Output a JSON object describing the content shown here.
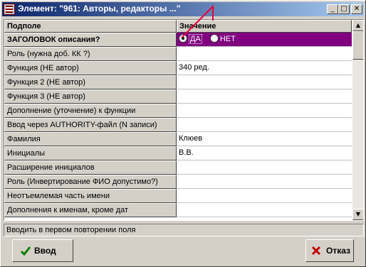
{
  "window": {
    "title": "Элемент: \"961: Авторы, редакторы ...\"",
    "minimize": "_",
    "maximize": "□",
    "close": "✕"
  },
  "grid": {
    "columns": [
      "Подполе",
      "Значение"
    ],
    "rows": [
      {
        "field": "ЗАГОЛОВОК описания?",
        "value": "",
        "type": "radio"
      },
      {
        "field": "Роль (нужна доб. КК ?)",
        "value": ""
      },
      {
        "field": "Функция (НЕ автор)",
        "value": "340 ред."
      },
      {
        "field": "Функция 2 (НЕ автор)",
        "value": ""
      },
      {
        "field": "Функция 3 (НЕ автор)",
        "value": ""
      },
      {
        "field": "Дополнение (уточнение) к функции",
        "value": ""
      },
      {
        "field": "Ввод через AUTHORITY-файл (N записи)",
        "value": ""
      },
      {
        "field": "Фамилия",
        "value": "Клюев"
      },
      {
        "field": "Инициалы",
        "value": "В.В."
      },
      {
        "field": "Расширение инициалов",
        "value": ""
      },
      {
        "field": "Роль (Инвертирование ФИО допустимо?)",
        "value": ""
      },
      {
        "field": "Неотъемлемая часть имени",
        "value": ""
      },
      {
        "field": "Дополнения к именам, кроме дат",
        "value": ""
      }
    ],
    "radio": {
      "yes": "ДА",
      "no": "НЕТ",
      "selected": "yes"
    },
    "selected_row_color": "#800080"
  },
  "status_text": "Вводить в первом повторении поля",
  "buttons": {
    "ok": {
      "label": "Ввод",
      "icon": "check-icon"
    },
    "cancel": {
      "label": "Отказ",
      "icon": "x-icon"
    }
  },
  "annotation_color": "#e8003a"
}
